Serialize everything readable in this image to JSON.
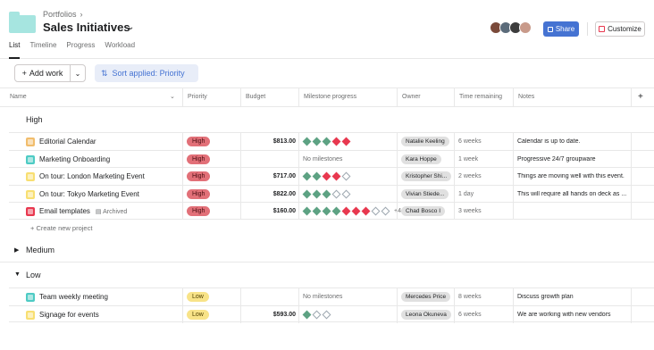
{
  "header": {
    "breadcrumb": "Portfolios",
    "title": "Sales Initiatives",
    "share_label": "Share",
    "customize_label": "Customize",
    "avatar_colors": [
      "#7a4a3a",
      "#5b6b7a",
      "#3c3c3c",
      "#c89a8a"
    ]
  },
  "tabs": [
    {
      "label": "List",
      "active": true
    },
    {
      "label": "Timeline",
      "active": false
    },
    {
      "label": "Progress",
      "active": false
    },
    {
      "label": "Workload",
      "active": false
    }
  ],
  "toolbar": {
    "add_work_label": "Add work",
    "sort_label": "Sort applied: Priority"
  },
  "columns": [
    "Name",
    "Priority",
    "Budget",
    "Milestone progress",
    "Owner",
    "Time remaining",
    "Notes"
  ],
  "sections": {
    "high": "High",
    "medium": "Medium",
    "low": "Low"
  },
  "create_new_label": "Create new project",
  "rows": [
    {
      "name": "Editorial Calendar",
      "icon_color": "#f1bd6c",
      "priority": "High",
      "budget": "$813.00",
      "milestones": [
        "g",
        "g",
        "g",
        "r",
        "r"
      ],
      "milestones_text": "",
      "owner": "Natalie Keeling",
      "time": "6 weeks",
      "notes": "Calendar is up to date."
    },
    {
      "name": "Marketing Onboarding",
      "icon_color": "#4ecbc4",
      "priority": "High",
      "budget": "",
      "milestones": [],
      "milestones_text": "No milestones",
      "owner": "Kara Hoppe",
      "time": "1 week",
      "notes": "Progressive 24/7 groupware"
    },
    {
      "name": "On tour: London Marketing Event",
      "icon_color": "#f8df72",
      "priority": "High",
      "budget": "$717.00",
      "milestones": [
        "g",
        "g",
        "r",
        "r",
        "o"
      ],
      "milestones_text": "",
      "owner": "Kristopher Shi...",
      "time": "2 weeks",
      "notes": "Things are moving well with this event."
    },
    {
      "name": "On tour: Tokyo Marketing Event",
      "icon_color": "#f8df72",
      "priority": "High",
      "budget": "$822.00",
      "milestones": [
        "g",
        "g",
        "g",
        "o",
        "o"
      ],
      "milestones_text": "",
      "owner": "Vivian Stiede...",
      "time": "1 day",
      "notes": "This will require all hands on deck as ..."
    },
    {
      "name": "Email templates",
      "icon_color": "#e8384f",
      "archived": "Archived",
      "priority": "High",
      "budget": "$160.00",
      "milestones": [
        "g",
        "g",
        "g",
        "g",
        "r",
        "r",
        "r",
        "o",
        "o"
      ],
      "milestones_text": "+4",
      "owner": "Chad Bosco I",
      "time": "3 weeks",
      "notes": ""
    },
    {
      "name": "Team weekly meeting",
      "icon_color": "#4ecbc4",
      "priority": "Low",
      "budget": "",
      "milestones": [],
      "milestones_text": "No milestones",
      "owner": "Mercedes Price",
      "time": "8 weeks",
      "notes": "Discuss growth plan"
    },
    {
      "name": "Signage for events",
      "icon_color": "#f8df72",
      "priority": "Low",
      "budget": "$593.00",
      "milestones": [
        "g",
        "o",
        "o"
      ],
      "milestones_text": "",
      "owner": "Leona Okuneva",
      "time": "6 weeks",
      "notes": "We are working with new vendors"
    }
  ]
}
